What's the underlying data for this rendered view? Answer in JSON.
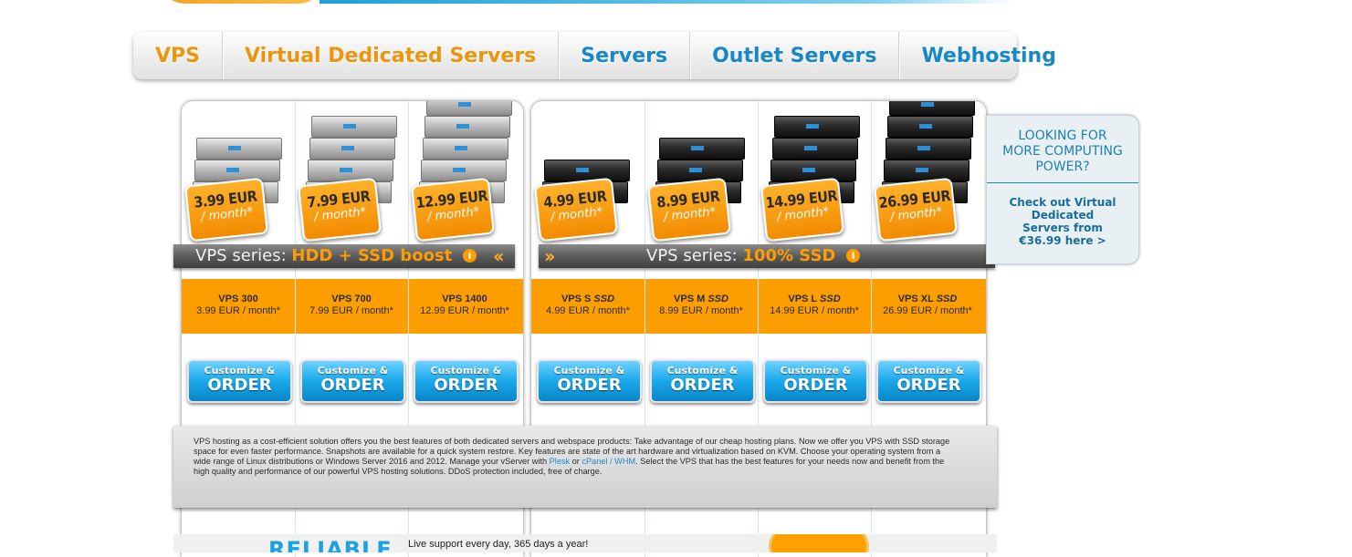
{
  "nav": {
    "items": [
      {
        "label": "VPS",
        "color": "orange"
      },
      {
        "label": "Virtual Dedicated Servers",
        "color": "orange"
      },
      {
        "label": "Servers",
        "color": "blue"
      },
      {
        "label": "Outlet Servers",
        "color": "blue"
      },
      {
        "label": "Webhosting",
        "color": "blue"
      }
    ]
  },
  "colors": {
    "accent_orange": "#fd9e00",
    "accent_blue": "#1887c6"
  },
  "series": {
    "hdd": {
      "prefix": "VPS series:",
      "highlight": "HDD + SSD boost",
      "info": "i"
    },
    "ssd": {
      "prefix": "VPS series:",
      "highlight": "100% SSD",
      "info": "i"
    }
  },
  "hdd_plans": [
    {
      "badge_price": "3.99 EUR",
      "badge_period": "/ month*",
      "name": "VPS 300",
      "name_suffix": "",
      "price": "3.99 EUR / month*",
      "btn_top": "Customize &",
      "btn_main": "ORDER",
      "server": "silver",
      "units": 3
    },
    {
      "badge_price": "7.99 EUR",
      "badge_period": "/ month*",
      "name": "VPS 700",
      "name_suffix": "",
      "price": "7.99 EUR / month*",
      "btn_top": "Customize &",
      "btn_main": "ORDER",
      "server": "silver",
      "units": 4
    },
    {
      "badge_price": "12.99 EUR",
      "badge_period": "/ month*",
      "name": "VPS 1400",
      "name_suffix": "",
      "price": "12.99 EUR / month*",
      "btn_top": "Customize &",
      "btn_main": "ORDER",
      "server": "silver",
      "units": 5
    }
  ],
  "ssd_plans": [
    {
      "badge_price": "4.99 EUR",
      "badge_period": "/ month*",
      "name": "VPS S",
      "name_suffix": "SSD",
      "price": "4.99 EUR / month*",
      "btn_top": "Customize &",
      "btn_main": "ORDER",
      "server": "black",
      "units": 2
    },
    {
      "badge_price": "8.99 EUR",
      "badge_period": "/ month*",
      "name": "VPS M",
      "name_suffix": "SSD",
      "price": "8.99 EUR / month*",
      "btn_top": "Customize &",
      "btn_main": "ORDER",
      "server": "black",
      "units": 3
    },
    {
      "badge_price": "14.99 EUR",
      "badge_period": "/ month*",
      "name": "VPS L",
      "name_suffix": "SSD",
      "price": "14.99 EUR / month*",
      "btn_top": "Customize &",
      "btn_main": "ORDER",
      "server": "black",
      "units": 4
    },
    {
      "badge_price": "26.99 EUR",
      "badge_period": "/ month*",
      "name": "VPS XL",
      "name_suffix": "SSD",
      "price": "26.99 EUR / month*",
      "btn_top": "Customize &",
      "btn_main": "ORDER",
      "server": "black",
      "units": 5
    }
  ],
  "description": {
    "before": "VPS hosting as a cost-efficient solution offers you the best features of both dedicated servers and webspace products: Take advantage of our cheap hosting plans. Now we offer you VPS with SSD storage space for even faster performance. Snapshots are available for a quick system restore. Key features are state of the art hardware and virtualization based on KVM. Choose your operating system from a wide range of Linux distributions or Windows Server 2016 and 2012. Manage your vServer with ",
    "link1": "Plesk",
    "middle": " or ",
    "link2": "cPanel / WHM",
    "after": ". Select the VPS that has the best features for your needs now and benefit from the high quality and performance of our powerful VPS hosting solutions. DDoS protection included, free of charge."
  },
  "side": {
    "question": "LOOKING FOR MORE COMPUTING POWER?",
    "cta": "Check out Virtual Dedicated Servers from €36.99 here >"
  },
  "bottom": {
    "reliable": "RELIABLE",
    "support": "Live support every day, 365 days a year!"
  }
}
